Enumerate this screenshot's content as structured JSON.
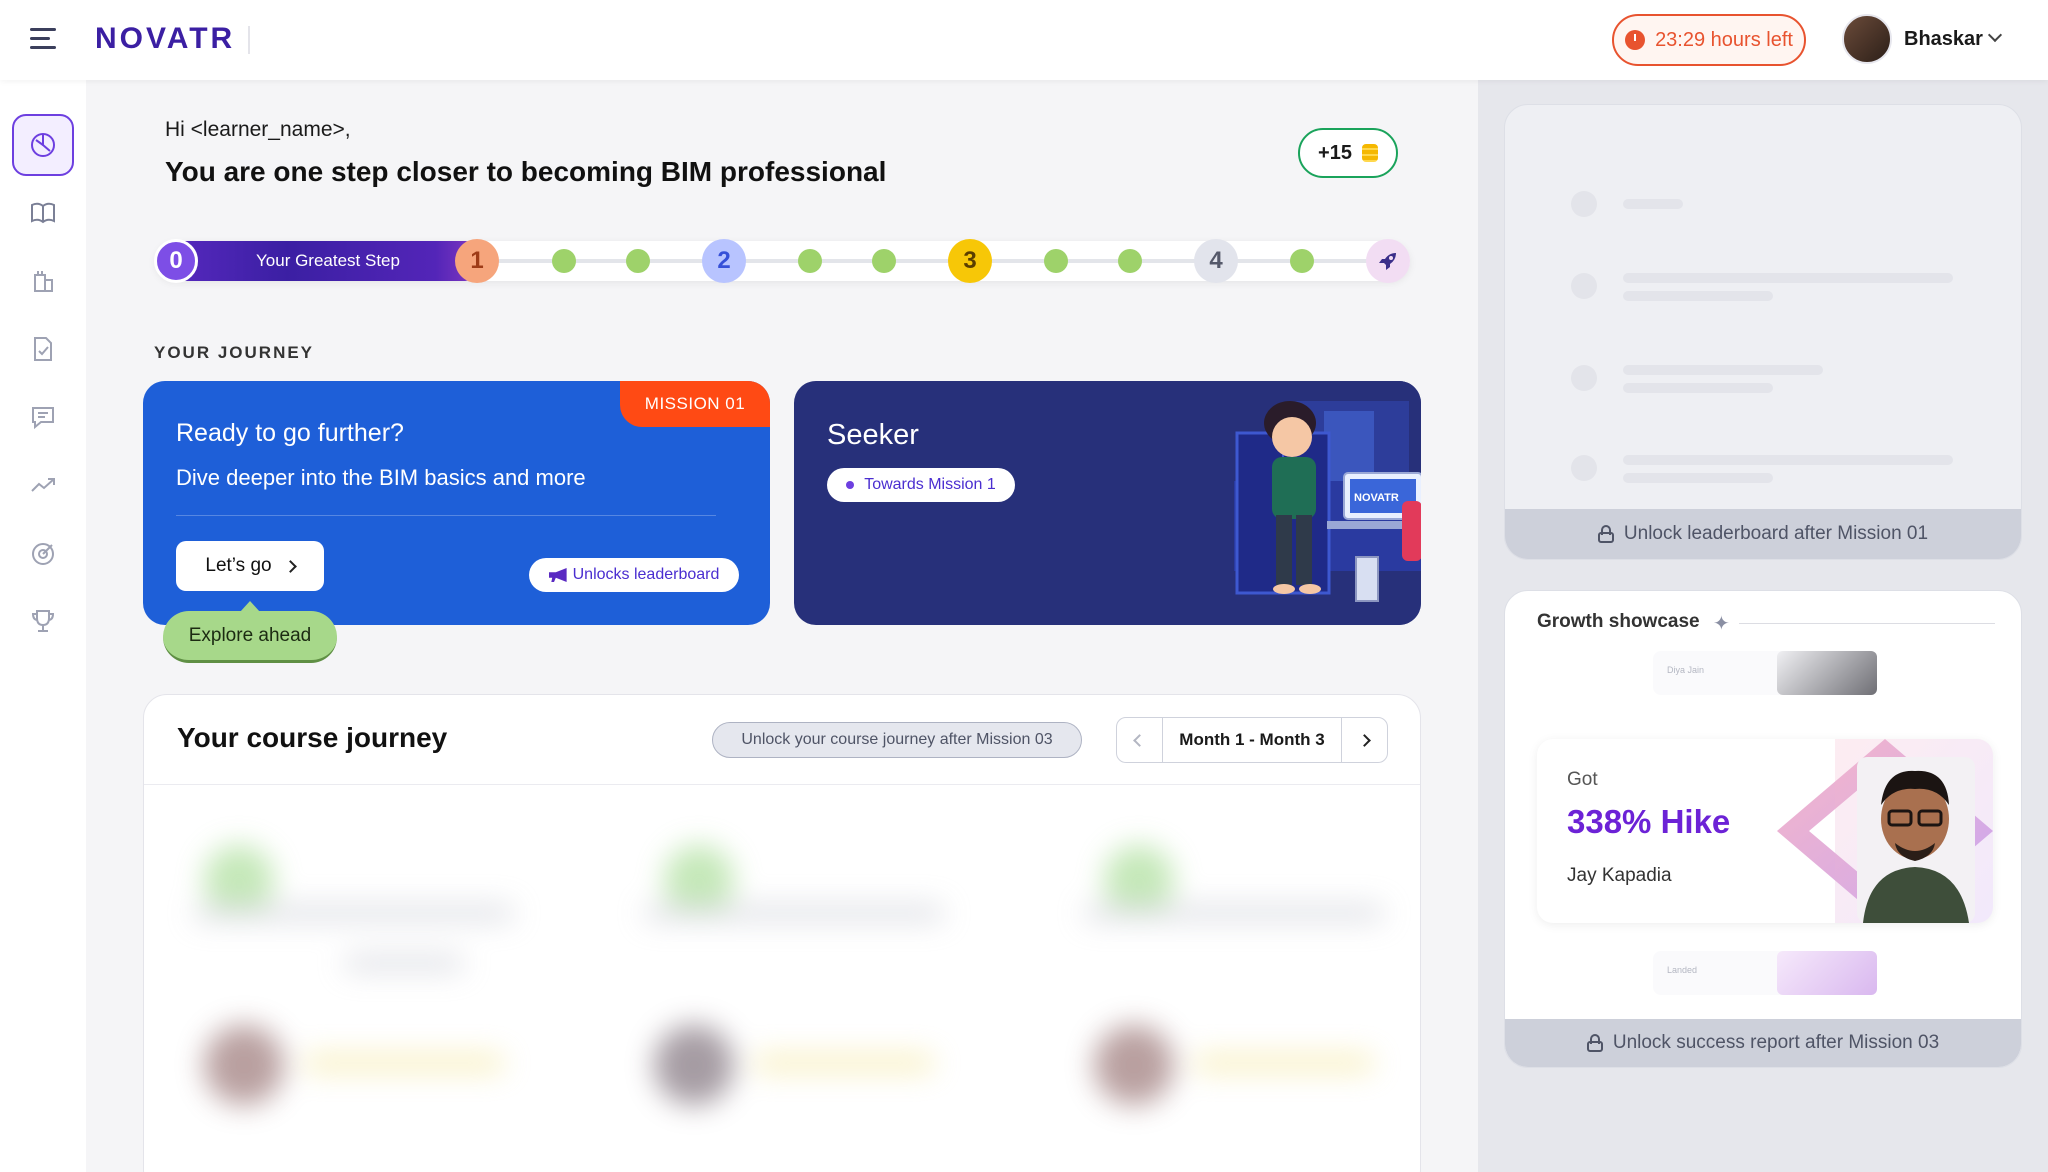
{
  "header": {
    "logo": "NOVATR",
    "timer_text": "23:29 hours left",
    "username": "Bhaskar"
  },
  "sidebar": {
    "items": [
      {
        "name": "dashboard",
        "icon": "dashboard-icon",
        "active": true
      },
      {
        "name": "courses",
        "icon": "book-icon"
      },
      {
        "name": "projects",
        "icon": "building-icon"
      },
      {
        "name": "assignments",
        "icon": "document-check-icon"
      },
      {
        "name": "messages",
        "icon": "chat-icon"
      },
      {
        "name": "progress",
        "icon": "trend-icon"
      },
      {
        "name": "goals",
        "icon": "target-icon"
      },
      {
        "name": "achievements",
        "icon": "trophy-icon"
      }
    ]
  },
  "greeting": {
    "hi": "Hi <learner_name>,",
    "headline": "You are one step closer to becoming BIM professional",
    "coins": "+15"
  },
  "progress": {
    "label": "Your Greatest Step",
    "milestones": [
      "0",
      "1",
      "2",
      "3",
      "4"
    ],
    "completed_fraction": 0.21
  },
  "journey": {
    "section_title": "YOUR JOURNEY",
    "mission_card": {
      "badge": "MISSION 01",
      "title": "Ready to go further?",
      "subtitle": "Dive deeper into the BIM basics and more",
      "cta": "Let’s go",
      "unlocks": "Unlocks leaderboard"
    },
    "explore": "Explore ahead",
    "seeker_card": {
      "title": "Seeker",
      "pill": "Towards Mission 1",
      "monitor_text": "NOVATR"
    }
  },
  "course_journey": {
    "title": "Your course journey",
    "lock_text": "Unlock your course journey after Mission 03",
    "month_range": "Month 1  -  Month 3"
  },
  "leaderboard": {
    "lock_text": "Unlock leaderboard after Mission 01"
  },
  "growth": {
    "title": "Growth showcase",
    "ghost_top_name": "Diya Jain",
    "ghost_bottom_label": "Landed",
    "hike_label": "Got",
    "hike_value": "338% Hike",
    "hike_name": "Jay Kapadia",
    "lock_text": "Unlock success report after Mission 03"
  },
  "colors": {
    "brand": "#3b1fa3",
    "mission_blue": "#1e5fd8",
    "seeker_navy": "#27307a",
    "mission_badge": "#ff4a14",
    "timer": "#e8532f",
    "hike": "#6c22d6"
  }
}
